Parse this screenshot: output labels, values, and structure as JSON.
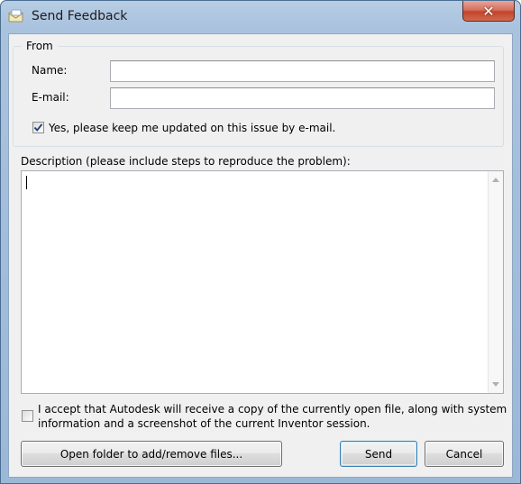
{
  "window": {
    "title": "Send Feedback",
    "close_glyph": "✕"
  },
  "from_group": {
    "title": "From",
    "name_label": "Name:",
    "name_value": "",
    "email_label": "E-mail:",
    "email_value": "",
    "keep_updated_label": "Yes, please keep me updated on this issue by e-mail.",
    "keep_updated_checked": true
  },
  "description": {
    "label": "Description (please include steps to reproduce the problem):",
    "value": ""
  },
  "accept": {
    "label_line1": "I accept that Autodesk will receive a copy of the currently open file, along with system",
    "label_line2": "information and a screenshot of the current Inventor session.",
    "checked": false
  },
  "buttons": {
    "open_folder": "Open folder to add/remove files...",
    "send": "Send",
    "cancel": "Cancel"
  },
  "icons": {
    "app": "feedback-envelope-icon",
    "close": "close-icon",
    "check": "checkmark-icon"
  }
}
